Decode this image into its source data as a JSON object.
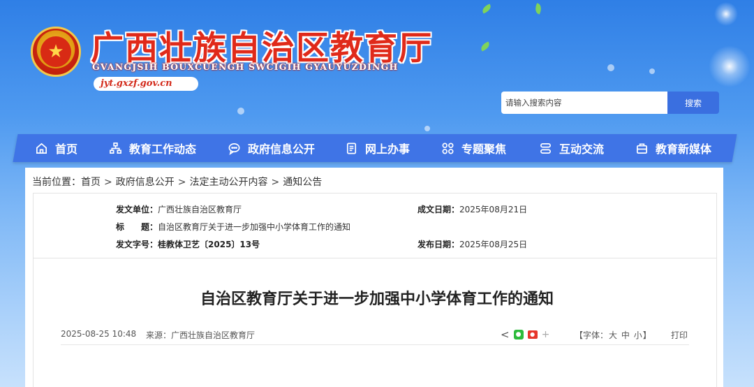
{
  "header": {
    "title": "广西壮族自治区教育厅",
    "subtitle": "GVANGJSIH BOUXCUENGH SWCIGIH GYAUYUZDINGH",
    "domain": "jyt.gxzf.gov.cn"
  },
  "search": {
    "placeholder": "请输入搜索内容",
    "button_label": "搜索"
  },
  "nav": {
    "items": [
      {
        "label": "首页",
        "icon": "home-icon"
      },
      {
        "label": "教育工作动态",
        "icon": "sitemap-icon"
      },
      {
        "label": "政府信息公开",
        "icon": "chat-icon"
      },
      {
        "label": "网上办事",
        "icon": "document-icon"
      },
      {
        "label": "专题聚焦",
        "icon": "grid-icon"
      },
      {
        "label": "互动交流",
        "icon": "exchange-icon"
      },
      {
        "label": "教育新媒体",
        "icon": "media-icon"
      }
    ]
  },
  "breadcrumb": {
    "prefix": "当前位置：",
    "items": [
      "首页",
      "政府信息公开",
      "法定主动公开内容",
      "通知公告"
    ],
    "separator": ">"
  },
  "meta": {
    "issuer_label": "发文单位：",
    "issuer": "广西壮族自治区教育厅",
    "created_label": "成文日期：",
    "created": "2025年08月21日",
    "title_label": "标　　题：",
    "title": "自治区教育厅关于进一步加强中小学体育工作的通知",
    "doc_no_label": "发文字号：",
    "doc_no": "桂教体卫艺〔2025〕13号",
    "published_label": "发布日期：",
    "published": "2025年08月25日"
  },
  "article": {
    "title": "自治区教育厅关于进一步加强中小学体育工作的通知",
    "datetime": "2025-08-25 10:48",
    "source": "来源：广西壮族自治区教育厅",
    "font_label_open": "【字体：",
    "font_large": "大",
    "font_medium": "中",
    "font_small": "小",
    "font_label_close": "】",
    "print_label": "打印"
  },
  "colors": {
    "nav_bg": "#3f74e6",
    "title_red": "#e02a1a",
    "search_btn": "#3a6fe0"
  }
}
